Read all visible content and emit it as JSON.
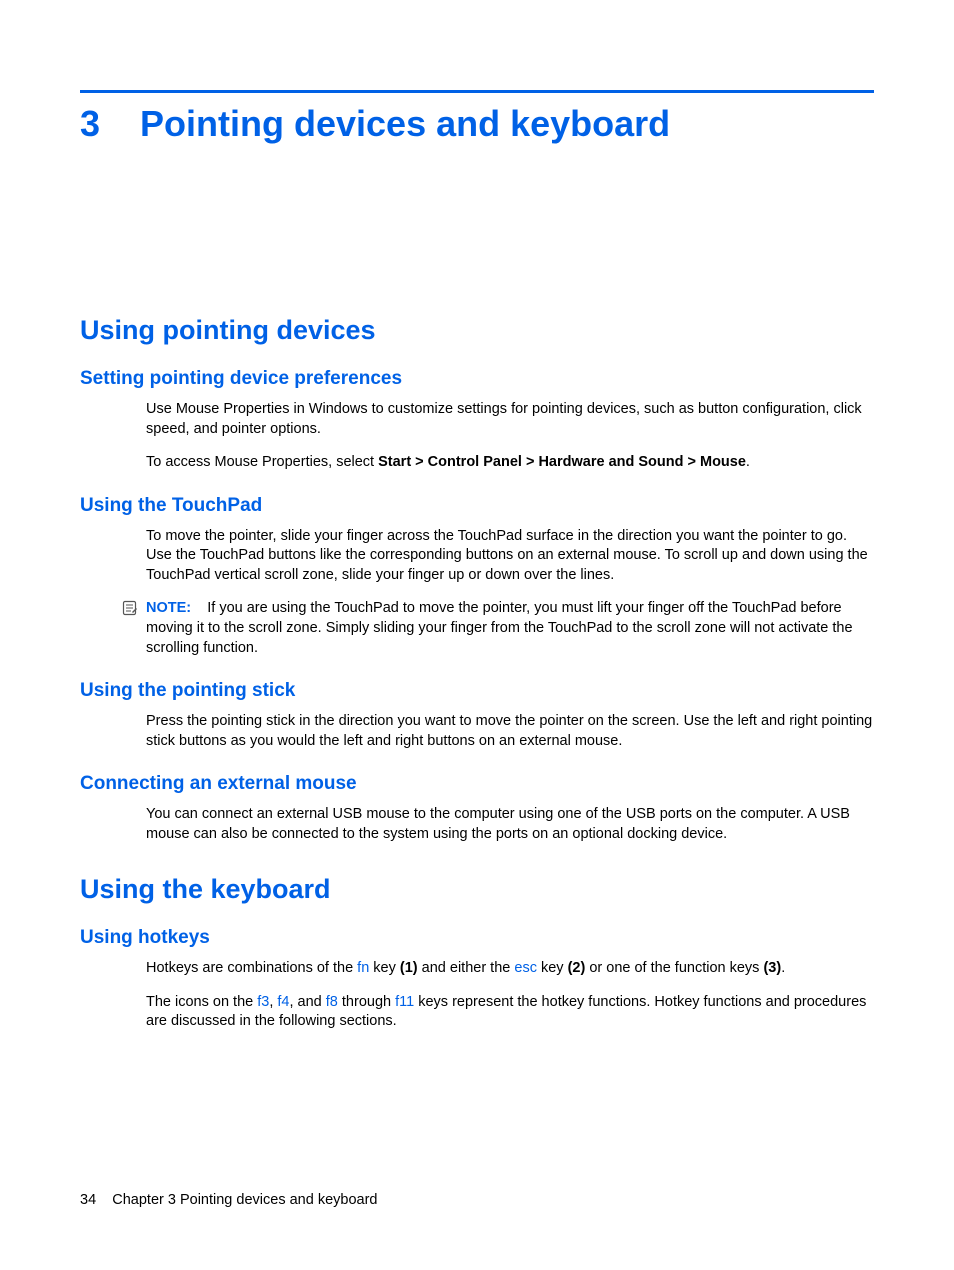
{
  "chapter": {
    "number": "3",
    "title": "Pointing devices and keyboard"
  },
  "section1": {
    "title": "Using pointing devices",
    "sub1": {
      "title": "Setting pointing device preferences",
      "p1": "Use Mouse Properties in Windows to customize settings for pointing devices, such as button configuration, click speed, and pointer options.",
      "p2a": "To access Mouse Properties, select ",
      "p2b": "Start > Control Panel > Hardware and Sound > Mouse",
      "p2c": "."
    },
    "sub2": {
      "title": "Using the TouchPad",
      "p1": "To move the pointer, slide your finger across the TouchPad surface in the direction you want the pointer to go. Use the TouchPad buttons like the corresponding buttons on an external mouse. To scroll up and down using the TouchPad vertical scroll zone, slide your finger up or down over the lines.",
      "note_label": "NOTE:",
      "note_body": "If you are using the TouchPad to move the pointer, you must lift your finger off the TouchPad before moving it to the scroll zone. Simply sliding your finger from the TouchPad to the scroll zone will not activate the scrolling function."
    },
    "sub3": {
      "title": "Using the pointing stick",
      "p1": "Press the pointing stick in the direction you want to move the pointer on the screen. Use the left and right pointing stick buttons as you would the left and right buttons on an external mouse."
    },
    "sub4": {
      "title": "Connecting an external mouse",
      "p1": "You can connect an external USB mouse to the computer using one of the USB ports on the computer. A USB mouse can also be connected to the system using the ports on an optional docking device."
    }
  },
  "section2": {
    "title": "Using the keyboard",
    "sub1": {
      "title": "Using hotkeys",
      "p1": {
        "a": "Hotkeys are combinations of the ",
        "k1": "fn",
        "b": " key ",
        "n1": "(1)",
        "c": " and either the ",
        "k2": "esc",
        "d": " key ",
        "n2": "(2)",
        "e": " or one of the function keys ",
        "n3": "(3)",
        "f": "."
      },
      "p2": {
        "a": "The icons on the ",
        "k1": "f3",
        "b": ", ",
        "k2": "f4",
        "c": ", and ",
        "k3": "f8",
        "d": " through ",
        "k4": "f11",
        "e": " keys represent the hotkey functions. Hotkey functions and procedures are discussed in the following sections."
      }
    }
  },
  "footer": {
    "page": "34",
    "chap_label": "Chapter 3   Pointing devices and keyboard"
  }
}
